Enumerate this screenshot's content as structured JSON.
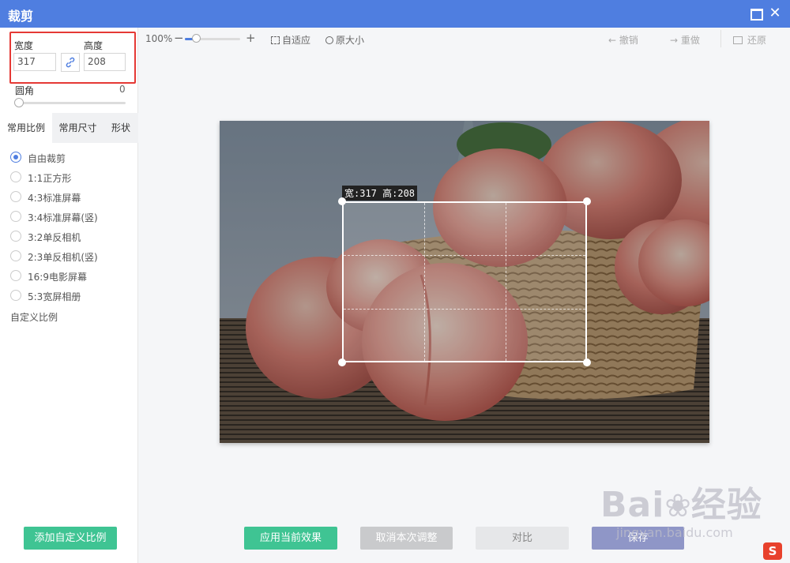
{
  "window": {
    "title": "裁剪",
    "close_glyph": "✕"
  },
  "size": {
    "width_label": "宽度",
    "height_label": "高度",
    "width_value": "317",
    "height_value": "208"
  },
  "corner": {
    "label": "圆角",
    "value": "0",
    "level": 0
  },
  "tabs": [
    {
      "label": "常用比例",
      "active": true
    },
    {
      "label": "常用尺寸",
      "active": false
    },
    {
      "label": "形状",
      "active": false
    }
  ],
  "ratios": [
    {
      "label": "自由裁剪",
      "checked": true
    },
    {
      "label": "1:1正方形",
      "checked": false
    },
    {
      "label": "4:3标准屏幕",
      "checked": false
    },
    {
      "label": "3:4标准屏幕(竖)",
      "checked": false
    },
    {
      "label": "3:2单反相机",
      "checked": false
    },
    {
      "label": "2:3单反相机(竖)",
      "checked": false
    },
    {
      "label": "16:9电影屏幕",
      "checked": false
    },
    {
      "label": "5:3宽屏相册",
      "checked": false
    }
  ],
  "custom_ratio_link": "自定义比例",
  "add_ratio_button": "添加自定义比例",
  "toolbar": {
    "zoom": "100%",
    "zoom_level": 0.2,
    "minus": "−",
    "plus": "+",
    "fit": "自适应",
    "original": "原大小",
    "undo": "撤销",
    "redo": "重做",
    "restore": "还原"
  },
  "crop_label": "宽:317 高:208",
  "buttons": {
    "apply": "应用当前效果",
    "cancel": "取消本次调整",
    "compare": "对比",
    "save": "保存"
  },
  "watermark": {
    "brand": "Bai",
    "brand2": "经验",
    "url": "jingyan.baidu.com"
  },
  "colors": {
    "titlebar": "#4f7ee0",
    "accent_green": "#3fc493",
    "highlight_red": "#e53935"
  }
}
